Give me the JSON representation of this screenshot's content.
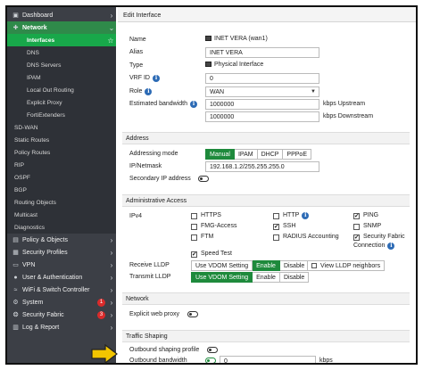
{
  "sidebar": {
    "items": [
      {
        "label": "Dashboard",
        "icon": "dashboard-icon",
        "glyph": "▣",
        "chev": "›"
      },
      {
        "label": "Network",
        "icon": "network-icon",
        "glyph": "✚",
        "chev": "⌄"
      },
      {
        "label": "Interfaces",
        "star": "☆"
      },
      {
        "label": "DNS"
      },
      {
        "label": "DNS Servers"
      },
      {
        "label": "IPAM"
      },
      {
        "label": "Local Out Routing"
      },
      {
        "label": "Explicit Proxy"
      },
      {
        "label": "FortiExtenders"
      },
      {
        "label": "SD-WAN"
      },
      {
        "label": "Static Routes"
      },
      {
        "label": "Policy Routes"
      },
      {
        "label": "RIP"
      },
      {
        "label": "OSPF"
      },
      {
        "label": "BGP"
      },
      {
        "label": "Routing Objects"
      },
      {
        "label": "Multicast"
      },
      {
        "label": "Diagnostics"
      },
      {
        "label": "Policy & Objects",
        "icon": "policy-icon",
        "glyph": "▤",
        "chev": "›"
      },
      {
        "label": "Security Profiles",
        "icon": "lock-icon",
        "glyph": "▦",
        "chev": "›"
      },
      {
        "label": "VPN",
        "icon": "vpn-icon",
        "glyph": "▭",
        "chev": "›"
      },
      {
        "label": "User & Authentication",
        "icon": "user-icon",
        "glyph": "●",
        "chev": "›"
      },
      {
        "label": "WiFi & Switch Controller",
        "icon": "wifi-icon",
        "glyph": "≈",
        "chev": "›"
      },
      {
        "label": "System",
        "icon": "gear-icon",
        "glyph": "⚙",
        "chev": "›",
        "badge": "1"
      },
      {
        "label": "Security Fabric",
        "icon": "fabric-icon",
        "glyph": "❂",
        "chev": "›",
        "badge": "3"
      },
      {
        "label": "Log & Report",
        "icon": "log-icon",
        "glyph": "▥",
        "chev": "›"
      }
    ]
  },
  "main": {
    "title": "Edit Interface",
    "name_label": "Name",
    "name_value": "INET VERA (wan1)",
    "alias_label": "Alias",
    "alias_value": "INET VERA",
    "type_label": "Type",
    "type_value": "Physical Interface",
    "vrf_label": "VRF ID",
    "vrf_value": "0",
    "role_label": "Role",
    "role_value": "WAN",
    "bw_label": "Estimated bandwidth",
    "bw_up_value": "1000000",
    "bw_up_unit": "kbps Upstream",
    "bw_down_value": "1000000",
    "bw_down_unit": "kbps Downstream"
  },
  "address": {
    "header": "Address",
    "mode_label": "Addressing mode",
    "modes": [
      "Manual",
      "IPAM",
      "DHCP",
      "PPPoE"
    ],
    "ip_label": "IP/Netmask",
    "ip_value": "192.168.1.2/255.255.255.0",
    "secondary_label": "Secondary IP address"
  },
  "admin": {
    "header": "Administrative Access",
    "ipv4_label": "IPv4",
    "options": [
      {
        "label": "HTTPS",
        "checked": false
      },
      {
        "label": "HTTP",
        "checked": false,
        "info": true
      },
      {
        "label": "PING",
        "checked": true
      },
      {
        "label": "FMG-Access",
        "checked": false
      },
      {
        "label": "SSH",
        "checked": true
      },
      {
        "label": "SNMP",
        "checked": false
      },
      {
        "label": "FTM",
        "checked": false
      },
      {
        "label": "RADIUS Accounting",
        "checked": false
      },
      {
        "label": "Security Fabric",
        "checked": true
      },
      {
        "label": "Connection",
        "checked": false,
        "info": true
      }
    ],
    "speed_test": "Speed Test",
    "rx_lldp_label": "Receive LLDP",
    "rx_lldp_options": [
      "Use VDOM Setting",
      "Enable",
      "Disable"
    ],
    "tx_lldp_label": "Transmit LLDP",
    "tx_lldp_options": [
      "Use VDOM Setting",
      "Enable",
      "Disable"
    ],
    "view_lldp": "View LLDP neighbors"
  },
  "network": {
    "header": "Network",
    "proxy_label": "Explicit web proxy"
  },
  "shaping": {
    "header": "Traffic Shaping",
    "profile_label": "Outbound shaping profile",
    "bandwidth_label": "Outbound bandwidth",
    "bandwidth_value": "0",
    "bandwidth_unit": "kbps"
  },
  "colors": {
    "sidebar_bg": "#3c3f46",
    "active_green": "#18a84a",
    "button_green": "#1e8a3c",
    "info_blue": "#2d6bb5",
    "arrow_yellow": "#f2c500"
  }
}
